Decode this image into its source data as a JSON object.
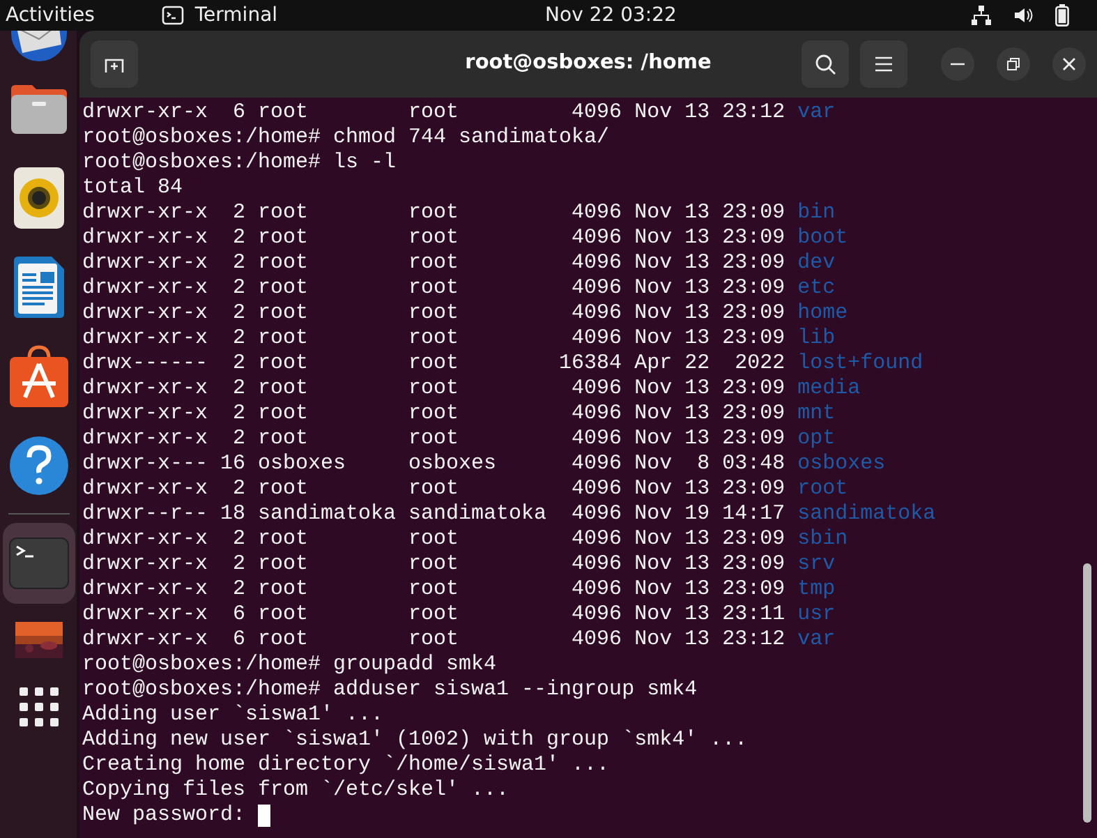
{
  "top_bar": {
    "activities": "Activities",
    "app_name": "Terminal",
    "clock": "Nov 22  03:22"
  },
  "window": {
    "title": "root@osboxes: /home"
  },
  "terminal": {
    "cursor_visible": true,
    "lines": [
      {
        "text": "drwxr-xr-x  6 root        root         4096 Nov 13 23:12 ",
        "dir": "var"
      },
      {
        "text": "root@osboxes:/home# chmod 744 sandimatoka/"
      },
      {
        "text": "root@osboxes:/home# ls -l"
      },
      {
        "text": "total 84"
      },
      {
        "text": "drwxr-xr-x  2 root        root         4096 Nov 13 23:09 ",
        "dir": "bin"
      },
      {
        "text": "drwxr-xr-x  2 root        root         4096 Nov 13 23:09 ",
        "dir": "boot"
      },
      {
        "text": "drwxr-xr-x  2 root        root         4096 Nov 13 23:09 ",
        "dir": "dev"
      },
      {
        "text": "drwxr-xr-x  2 root        root         4096 Nov 13 23:09 ",
        "dir": "etc"
      },
      {
        "text": "drwxr-xr-x  2 root        root         4096 Nov 13 23:09 ",
        "dir": "home"
      },
      {
        "text": "drwxr-xr-x  2 root        root         4096 Nov 13 23:09 ",
        "dir": "lib"
      },
      {
        "text": "drwx------  2 root        root        16384 Apr 22  2022 ",
        "dir": "lost+found"
      },
      {
        "text": "drwxr-xr-x  2 root        root         4096 Nov 13 23:09 ",
        "dir": "media"
      },
      {
        "text": "drwxr-xr-x  2 root        root         4096 Nov 13 23:09 ",
        "dir": "mnt"
      },
      {
        "text": "drwxr-xr-x  2 root        root         4096 Nov 13 23:09 ",
        "dir": "opt"
      },
      {
        "text": "drwxr-x--- 16 osboxes     osboxes      4096 Nov  8 03:48 ",
        "dir": "osboxes"
      },
      {
        "text": "drwxr-xr-x  2 root        root         4096 Nov 13 23:09 ",
        "dir": "root"
      },
      {
        "text": "drwxr--r-- 18 sandimatoka sandimatoka  4096 Nov 19 14:17 ",
        "dir": "sandimatoka"
      },
      {
        "text": "drwxr-xr-x  2 root        root         4096 Nov 13 23:09 ",
        "dir": "sbin"
      },
      {
        "text": "drwxr-xr-x  2 root        root         4096 Nov 13 23:09 ",
        "dir": "srv"
      },
      {
        "text": "drwxr-xr-x  2 root        root         4096 Nov 13 23:09 ",
        "dir": "tmp"
      },
      {
        "text": "drwxr-xr-x  6 root        root         4096 Nov 13 23:11 ",
        "dir": "usr"
      },
      {
        "text": "drwxr-xr-x  6 root        root         4096 Nov 13 23:12 ",
        "dir": "var"
      },
      {
        "text": "root@osboxes:/home# groupadd smk4"
      },
      {
        "text": "root@osboxes:/home# adduser siswa1 --ingroup smk4"
      },
      {
        "text": "Adding user `siswa1' ..."
      },
      {
        "text": "Adding new user `siswa1' (1002) with group `smk4' ..."
      },
      {
        "text": "Creating home directory `/home/siswa1' ..."
      },
      {
        "text": "Copying files from `/etc/skel' ..."
      },
      {
        "text": "New password: "
      }
    ]
  }
}
